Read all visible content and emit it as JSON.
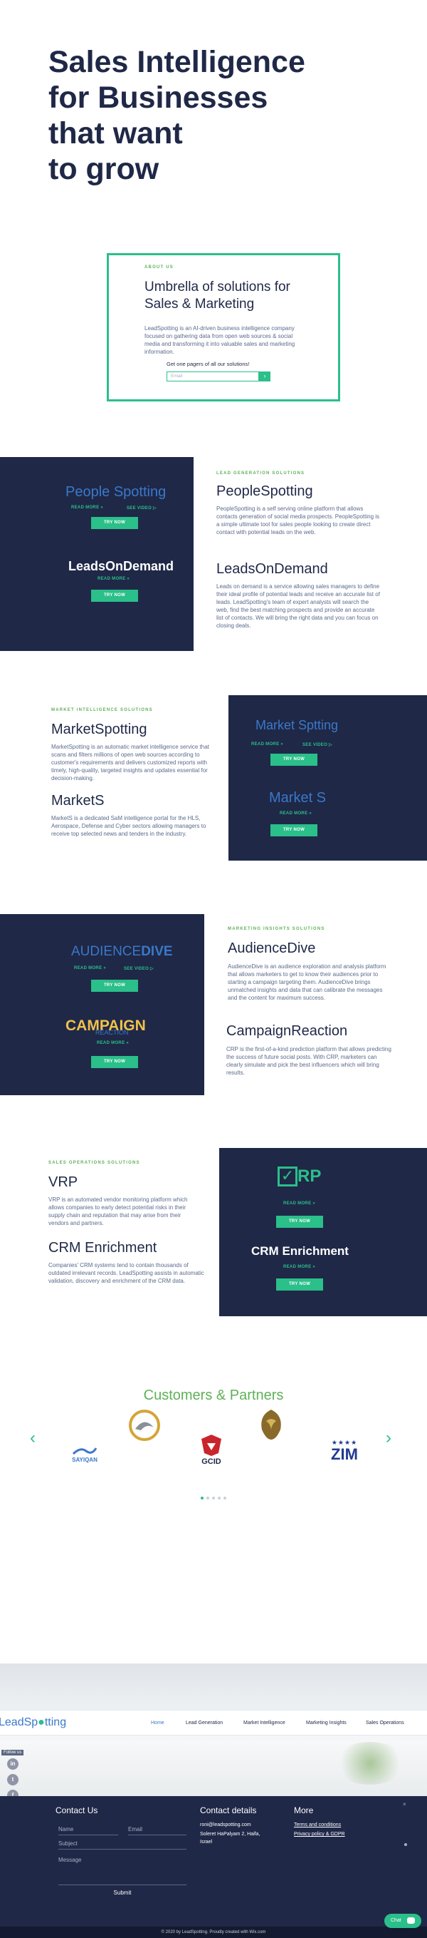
{
  "hero": {
    "title_line1": "Sales Intelligence",
    "title_line2": "for Businesses",
    "title_line3": "that want",
    "title_line4": "to grow"
  },
  "about": {
    "eyebrow": "ABOUT US",
    "heading_line1": "Umbrella of solutions for",
    "heading_line2": "Sales & Marketing",
    "body": "LeadSpotting is an AI-driven business intelligence company focused on gathering data from open web sources & social media and transforming it into valuable sales and marketing information.",
    "cta_text": "Get one pagers of all our solutions!",
    "email_placeholder": "Email",
    "submit_symbol": "›"
  },
  "lead_gen": {
    "eyebrow": "LEAD GENERATION SOLUTIONS",
    "p1_logo_a": "People",
    "p1_logo_b": "Spotting",
    "p1_read_more": "READ MORE",
    "p1_see_video": "SEE VIDEO",
    "p1_try": "TRY NOW",
    "p2_logo": "LeadsOnDemand",
    "p2_read_more": "READ MORE",
    "p2_try": "TRY NOW",
    "p1_title": "PeopleSpotting",
    "p1_body": "PeopleSpotting is a self serving online platform that allows contacts generation of social media prospects. PeopleSpotting is a simple ultimate tool for sales people looking to create direct contact with potential leads on the web.",
    "p2_title": "LeadsOnDemand",
    "p2_body": "Leads on demand is a service allowing sales managers to define their ideal profile of potential leads and receive an accurate list of leads. LeadSpotting's team of expert analysts will search the web, find the best matching prospects and provide an accurate list of contacts. We will bring the right data and you can focus on closing deals."
  },
  "market_intel": {
    "eyebrow": "MARKET INTELLIGENCE SOLUTIONS",
    "p1_title": "MarketSpotting",
    "p1_body": "MarketSpotting is an automatic market intelligence service that scans and filters millions of open web sources according to customer's requirements and delivers customized reports with timely, high-quality, targeted insights and updates essential for decision-making.",
    "p2_title": "MarketS",
    "p2_body": "MarketS is a dedicated SaM intelligence portal for the HLS, Aerospace, Defense and Cyber sectors allowing managers to receive top selected news and tenders in the industry.",
    "p1_logo_a": "Market Sp",
    "p1_logo_b": "tting",
    "p1_read_more": "READ MORE",
    "p1_see_video": "SEE VIDEO",
    "p1_try": "TRY NOW",
    "p2_logo": "Market S",
    "p2_read_more": "READ MORE",
    "p2_try": "TRY NOW"
  },
  "marketing_insights": {
    "eyebrow": "MARKETING INSIGHTS SOLUTIONS",
    "p1_logo_a": "AUDIENCE",
    "p1_logo_b": "DIVE",
    "p1_read_more": "READ MORE",
    "p1_see_video": "SEE VIDEO",
    "p1_try": "TRY NOW",
    "p2_logo_a": "CAMPAIGN",
    "p2_logo_b": "REACTION",
    "p2_read_more": "READ MORE",
    "p2_try": "TRY NOW",
    "p1_title": "AudienceDive",
    "p1_body": "AudienceDive is an audience exploration and analysis platform that allows marketers to get to know their audiences prior to starting a campaign targeting them. AudienceDive brings unmatched insights and data that can calibrate the messages and the content for maximum success.",
    "p2_title": "CampaignReaction",
    "p2_body": "CRP is the first-of-a-kind prediction platform that allows predicting the success of future social posts. With CRP, marketers can clearly simulate and pick the best influencers which will bring results."
  },
  "sales_ops": {
    "eyebrow": "SALES OPERATIONS SOLUTIONS",
    "p1_title": "VRP",
    "p1_body": "VRP is an automated vendor monitoring platform which allows companies to early detect potential risks in their supply chain and reputation that may arise from their vendors and partners.",
    "p2_title": "CRM Enrichment",
    "p2_body": "Companies' CRM systems tend to contain thousands of outdated irrelevant records. LeadSpotting assists in automatic validation, discovery and enrichment of the CRM data.",
    "p1_logo": "RP",
    "p1_read_more": "READ MORE",
    "p1_try": "TRY NOW",
    "p2_logo": "CRM Enrichment",
    "p2_read_more": "READ MORE",
    "p2_try": "TRY NOW"
  },
  "partners": {
    "title": "Customers & Partners",
    "logo1": "SAYIQAN",
    "logo3": "GCID",
    "logo5_stars": "★★★★",
    "logo5": "ZIM",
    "prev": "‹",
    "next": "›"
  },
  "nav": {
    "logo_a": "Lead",
    "logo_b": "Sp",
    "logo_c": "tting",
    "items": [
      "Home",
      "Lead Generation",
      "Market Intelligence",
      "Marketing Insights",
      "Sales Operations"
    ]
  },
  "social": {
    "follow": "Follow us",
    "icons": [
      "in",
      "t",
      "f",
      "▶"
    ]
  },
  "footer": {
    "contact_title": "Contact Us",
    "name_placeholder": "Name",
    "email_placeholder": "Email",
    "subject_placeholder": "Subject",
    "message_placeholder": "Message",
    "submit": "Submit",
    "details_title": "Contact details",
    "email": "roni@leadspotting.com",
    "address_line1": "Soleret HaPalyam 2, Haifa,",
    "address_line2": "Israel",
    "more_title": "More",
    "terms": "Terms and conditions",
    "privacy": "Privacy policy & GDPR",
    "copyright": "© 2020 by LeadSpotting. Proudly created with Wix.com",
    "chat": "Chat"
  },
  "colors": {
    "navy": "#1f2847",
    "green": "#2bbf8a",
    "eyebrow_green": "#5fb157",
    "logo_blue": "#3a78c9"
  }
}
